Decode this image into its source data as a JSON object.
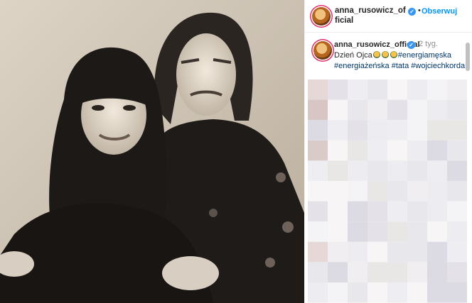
{
  "post": {
    "author_handle": "anna_rusowicz_official",
    "follow_label": "Obserwuj",
    "separator": "•",
    "verified_mark": "✓"
  },
  "caption": {
    "author_handle": "anna_rusowicz_official",
    "time_ago": "2 tyg.",
    "text_main": "Dzień Ojca",
    "hashtags": [
      "#energiamęska",
      "#energiażeńska",
      "#tata",
      "#wojciechkorda"
    ]
  },
  "colors": {
    "link_blue": "#0095f6",
    "hashtag": "#00376b",
    "verified": "#3897f0",
    "muted": "#8e8e8e"
  },
  "icons": {
    "verified": "verified-badge-icon",
    "avatar": "profile-avatar"
  }
}
